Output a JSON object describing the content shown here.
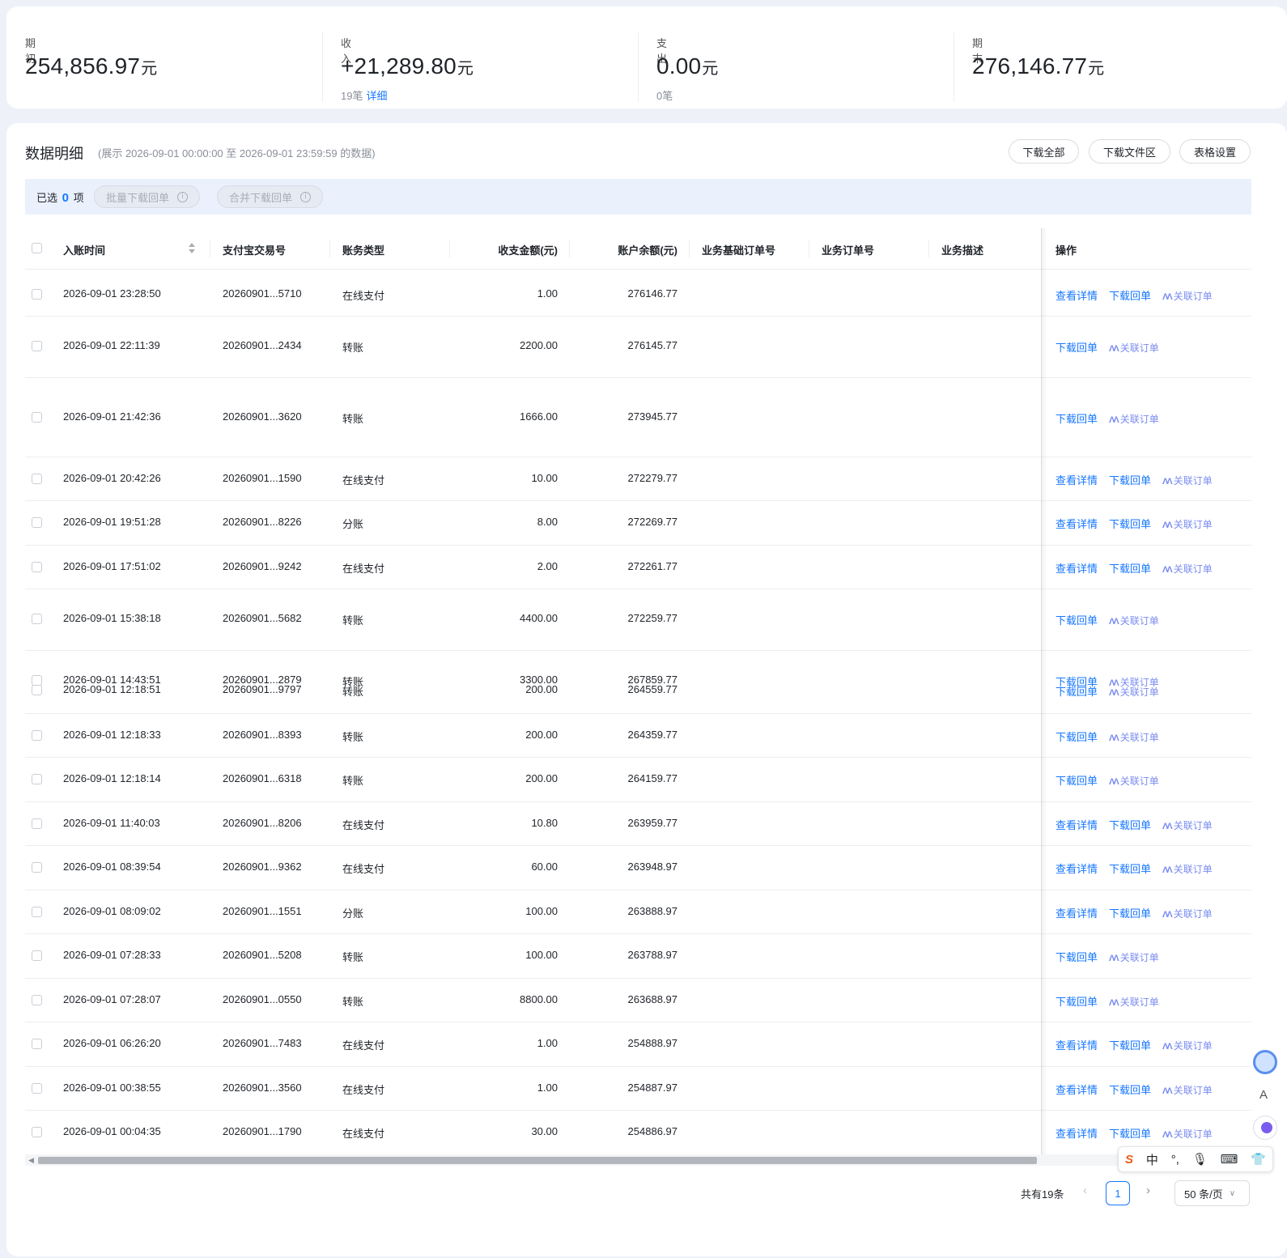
{
  "summary": {
    "opening": {
      "label": "期初",
      "amount": "254,856.97",
      "unit": "元"
    },
    "income": {
      "label": "收入",
      "amount": "+21,289.80",
      "unit": "元",
      "count": "19笔",
      "detail_link": "详细"
    },
    "expense": {
      "label": "支出",
      "amount": "0.00",
      "unit": "元",
      "count": "0笔"
    },
    "closing": {
      "label": "期末",
      "amount": "276,146.77",
      "unit": "元"
    }
  },
  "detail": {
    "title": "数据明细",
    "range_note": "(展示 2026-09-01 00:00:00 至 2026-09-01 23:59:59 的数据)",
    "buttons": {
      "download_all": "下载全部",
      "download_files": "下载文件区",
      "table_settings": "表格设置"
    },
    "selection": {
      "prefix": "已选",
      "count": "0",
      "suffix": "项",
      "batch_download": "批量下载回单",
      "merge_download": "合并下载回单"
    },
    "columns": {
      "time": "入账时间",
      "trade_no": "支付宝交易号",
      "type": "账务类型",
      "amount": "收支金额(元)",
      "balance": "账户余额(元)",
      "base_order": "业务基础订单号",
      "order": "业务订单号",
      "desc": "业务描述",
      "ops": "操作"
    },
    "op_labels": {
      "view": "查看详情",
      "download": "下载回单",
      "relate": "关联订单"
    },
    "rows": [
      {
        "time": "2026-09-01 23:28:50",
        "trade_no": "20260901...5710",
        "type": "在线支付",
        "amount": "1.00",
        "balance": "276146.77",
        "view": true
      },
      {
        "time": "2026-09-01 22:11:39",
        "trade_no": "20260901...2434",
        "type": "转账",
        "amount": "2200.00",
        "balance": "276145.77",
        "view": false
      },
      {
        "time": "2026-09-01 21:42:36",
        "trade_no": "20260901...3620",
        "type": "转账",
        "amount": "1666.00",
        "balance": "273945.77",
        "view": false
      },
      {
        "time": "2026-09-01 20:42:26",
        "trade_no": "20260901...1590",
        "type": "在线支付",
        "amount": "10.00",
        "balance": "272279.77",
        "view": true
      },
      {
        "time": "2026-09-01 19:51:28",
        "trade_no": "20260901...8226",
        "type": "分账",
        "amount": "8.00",
        "balance": "272269.77",
        "view": true
      },
      {
        "time": "2026-09-01 17:51:02",
        "trade_no": "20260901...9242",
        "type": "在线支付",
        "amount": "2.00",
        "balance": "272261.77",
        "view": true
      },
      {
        "time": "2026-09-01 15:38:18",
        "trade_no": "20260901...5682",
        "type": "转账",
        "amount": "4400.00",
        "balance": "272259.77",
        "view": false
      },
      {
        "time": "2026-09-01 14:43:51",
        "trade_no": "20260901...2879",
        "type": "转账",
        "amount": "3300.00",
        "balance": "267859.77",
        "view": false
      },
      {
        "time": "2026-09-01 12:18:51",
        "trade_no": "20260901...9797",
        "type": "转账",
        "amount": "200.00",
        "balance": "264559.77",
        "view": false
      },
      {
        "time": "2026-09-01 12:18:33",
        "trade_no": "20260901...8393",
        "type": "转账",
        "amount": "200.00",
        "balance": "264359.77",
        "view": false
      },
      {
        "time": "2026-09-01 12:18:14",
        "trade_no": "20260901...6318",
        "type": "转账",
        "amount": "200.00",
        "balance": "264159.77",
        "view": false
      },
      {
        "time": "2026-09-01 11:40:03",
        "trade_no": "20260901...8206",
        "type": "在线支付",
        "amount": "10.80",
        "balance": "263959.77",
        "view": true
      },
      {
        "time": "2026-09-01 08:39:54",
        "trade_no": "20260901...9362",
        "type": "在线支付",
        "amount": "60.00",
        "balance": "263948.97",
        "view": true
      },
      {
        "time": "2026-09-01 08:09:02",
        "trade_no": "20260901...1551",
        "type": "分账",
        "amount": "100.00",
        "balance": "263888.97",
        "view": true
      },
      {
        "time": "2026-09-01 07:28:33",
        "trade_no": "20260901...5208",
        "type": "转账",
        "amount": "100.00",
        "balance": "263788.97",
        "view": false
      },
      {
        "time": "2026-09-01 07:28:07",
        "trade_no": "20260901...0550",
        "type": "转账",
        "amount": "8800.00",
        "balance": "263688.97",
        "view": false
      },
      {
        "time": "2026-09-01 06:26:20",
        "trade_no": "20260901...7483",
        "type": "在线支付",
        "amount": "1.00",
        "balance": "254888.97",
        "view": true
      },
      {
        "time": "2026-09-01 00:38:55",
        "trade_no": "20260901...3560",
        "type": "在线支付",
        "amount": "1.00",
        "balance": "254887.97",
        "view": true
      },
      {
        "time": "2026-09-01 00:04:35",
        "trade_no": "20260901...1790",
        "type": "在线支付",
        "amount": "30.00",
        "balance": "254886.97",
        "view": true
      }
    ],
    "pagination": {
      "total": "共有19条",
      "current_page": "1",
      "page_size": "50 条/页"
    }
  },
  "ime_toolbar": {
    "lang": "中"
  },
  "side_panel": {
    "letter": "A"
  }
}
